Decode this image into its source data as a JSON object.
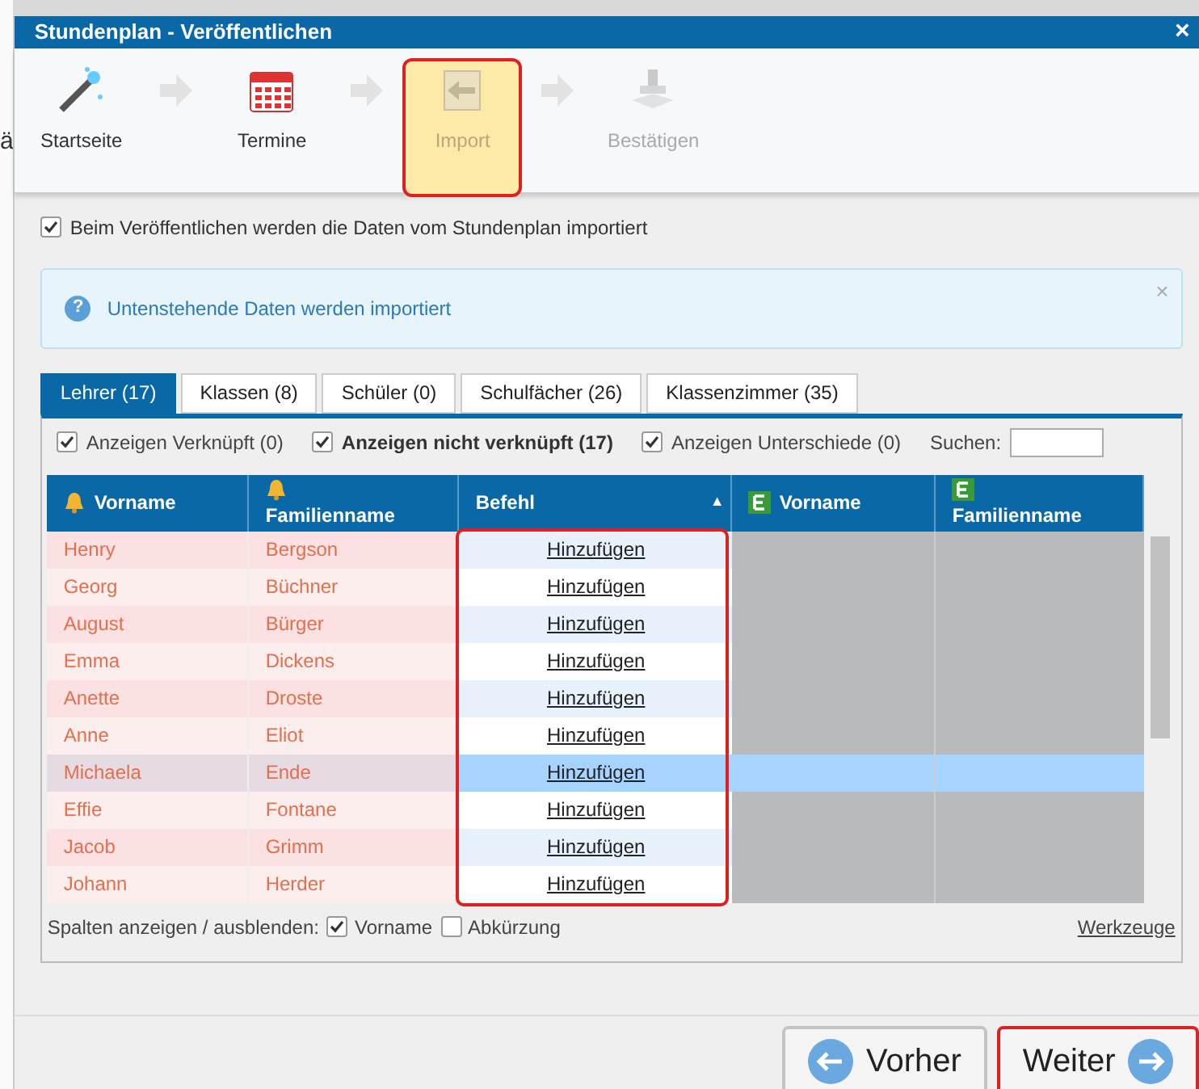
{
  "background_fragment": "ä",
  "window": {
    "title": "Stundenplan - Veröffentlichen",
    "close": "×"
  },
  "steps": [
    {
      "label": "Startseite",
      "kind": "wand",
      "selected": false,
      "disabled": false,
      "highlighted": false
    },
    {
      "label": "Termine",
      "kind": "calendar",
      "selected": false,
      "disabled": false,
      "highlighted": false
    },
    {
      "label": "Import",
      "kind": "import",
      "selected": true,
      "disabled": false,
      "highlighted": true
    },
    {
      "label": "Bestätigen",
      "kind": "stamp",
      "selected": false,
      "disabled": true,
      "highlighted": false
    }
  ],
  "import_option": {
    "label": "Beim Veröffentlichen werden die Daten vom Stundenplan importiert",
    "checked": true
  },
  "info": {
    "icon_text": "?",
    "text": "Untenstehende Daten werden importiert",
    "close": "×"
  },
  "tabs": [
    {
      "label": "Lehrer (17)",
      "selected": true
    },
    {
      "label": "Klassen (8)",
      "selected": false
    },
    {
      "label": "Schüler (0)",
      "selected": false
    },
    {
      "label": "Schulfächer (26)",
      "selected": false
    },
    {
      "label": "Klassenzimmer (35)",
      "selected": false
    }
  ],
  "filters": [
    {
      "label": "Anzeigen Verknüpft (0)",
      "checked": true,
      "bold": false
    },
    {
      "label": "Anzeigen nicht verknüpft (17)",
      "checked": true,
      "bold": true
    },
    {
      "label": "Anzeigen Unterschiede (0)",
      "checked": true,
      "bold": false
    }
  ],
  "search": {
    "label": "Suchen:"
  },
  "table": {
    "columns": [
      {
        "label": "Vorname",
        "kind": "bell",
        "stacked": false
      },
      {
        "label": "Familienname",
        "kind": "bell",
        "stacked": true
      },
      {
        "label": "Befehl",
        "kind": "sort",
        "sort_arrow": "▲",
        "stacked": false,
        "highlighted": true
      },
      {
        "label": "Vorname",
        "kind": "e",
        "stacked": false
      },
      {
        "label": "Familienname",
        "kind": "e",
        "stacked": true
      }
    ],
    "rows": [
      {
        "first": "Henry",
        "last": "Bergson",
        "action": "Hinzufügen",
        "selected": false
      },
      {
        "first": "Georg",
        "last": "Büchner",
        "action": "Hinzufügen",
        "selected": false
      },
      {
        "first": "August",
        "last": "Bürger",
        "action": "Hinzufügen",
        "selected": false
      },
      {
        "first": "Emma",
        "last": "Dickens",
        "action": "Hinzufügen",
        "selected": false
      },
      {
        "first": "Anette",
        "last": "Droste",
        "action": "Hinzufügen",
        "selected": false
      },
      {
        "first": "Anne",
        "last": "Eliot",
        "action": "Hinzufügen",
        "selected": false
      },
      {
        "first": "Michaela",
        "last": "Ende",
        "action": "Hinzufügen",
        "selected": true
      },
      {
        "first": "Effie",
        "last": "Fontane",
        "action": "Hinzufügen",
        "selected": false
      },
      {
        "first": "Jacob",
        "last": "Grimm",
        "action": "Hinzufügen",
        "selected": false
      },
      {
        "first": "Johann",
        "last": "Herder",
        "action": "Hinzufügen",
        "selected": false
      }
    ]
  },
  "columns_toggle": {
    "label": "Spalten anzeigen / ausblenden:",
    "options": [
      {
        "label": "Vorname",
        "checked": true
      },
      {
        "label": "Abkürzung",
        "checked": false
      }
    ]
  },
  "tools_link": "Werkzeuge",
  "buttons": [
    {
      "label": "Vorher",
      "kind": "back",
      "highlighted": false
    },
    {
      "label": "Weiter",
      "kind": "next",
      "highlighted": true
    }
  ]
}
